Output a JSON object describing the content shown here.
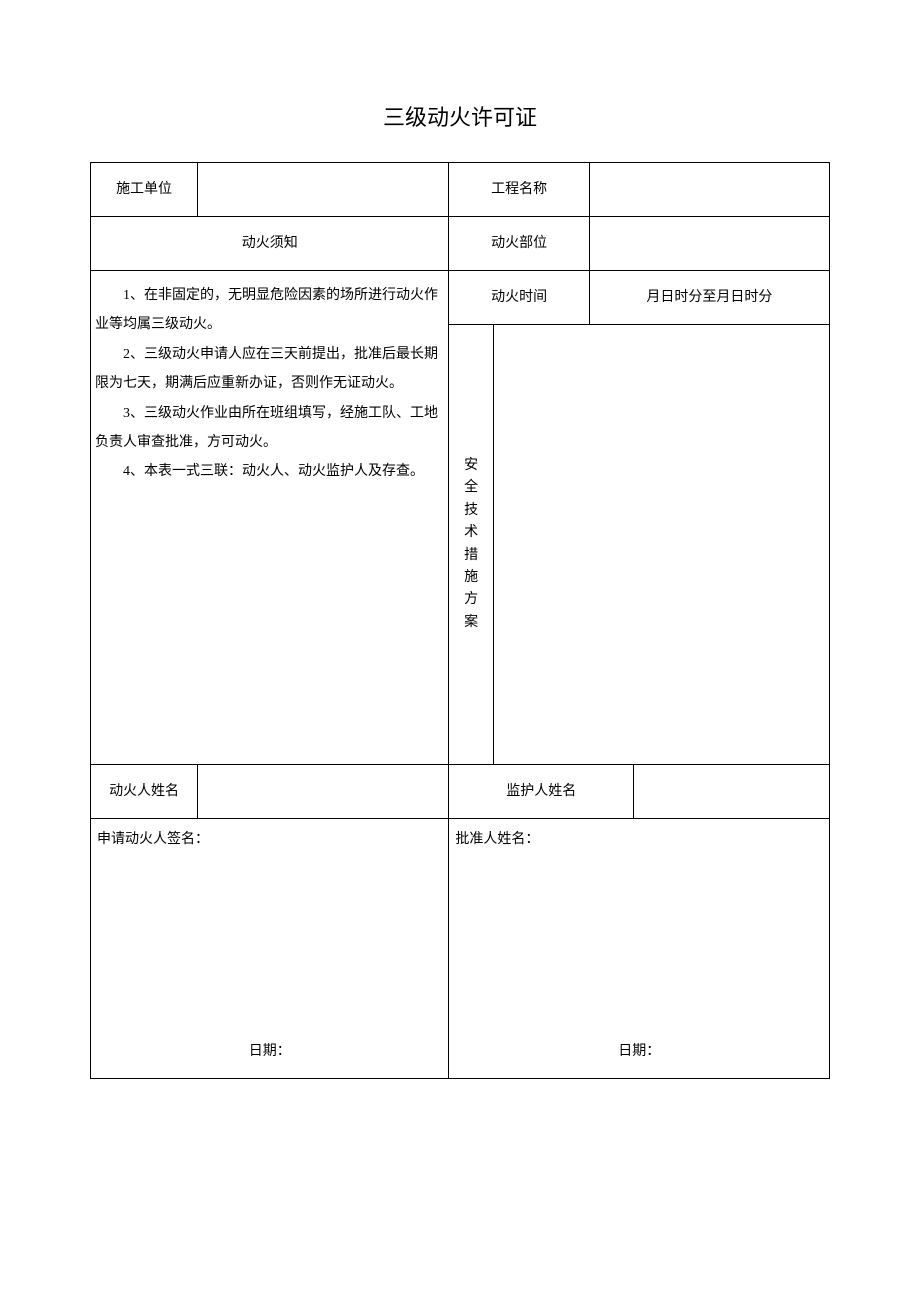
{
  "title": "三级动火许可证",
  "labels": {
    "construction_unit": "施工单位",
    "project_name": "工程名称",
    "fire_notice": "动火须知",
    "fire_location": "动火部位",
    "fire_time": "动火时间",
    "fire_time_value": "月日时分至月日时分",
    "safety_measures": "安全技术措施方案",
    "fire_person_name": "动火人姓名",
    "guardian_name": "监护人姓名",
    "applicant_sign": "申请动火人签名：",
    "approver_name": "批准人姓名：",
    "date": "日期："
  },
  "notice": {
    "item1": "1、在非固定的，无明显危险因素的场所进行动火作业等均属三级动火。",
    "item2": "2、三级动火申请人应在三天前提出，批准后最长期限为七天，期满后应重新办证，否则作无证动火。",
    "item3": "3、三级动火作业由所在班组填写，经施工队、工地负责人审查批准，方可动火。",
    "item4": "4、本表一式三联：动火人、动火监护人及存查。"
  },
  "values": {
    "construction_unit": "",
    "project_name": "",
    "fire_location": "",
    "safety_measures": "",
    "fire_person_name": "",
    "guardian_name": ""
  }
}
